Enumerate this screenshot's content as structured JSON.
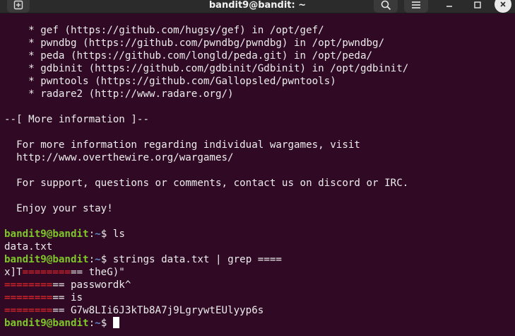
{
  "window": {
    "title": "bandit9@bandit: ~"
  },
  "prompt": {
    "user_host": "bandit9@bandit",
    "sep": ":",
    "path": "~",
    "dollar": "$"
  },
  "tools": [
    "    * gef (https://github.com/hugsy/gef) in /opt/gef/",
    "    * pwndbg (https://github.com/pwndbg/pwndbg) in /opt/pwndbg/",
    "    * peda (https://github.com/longld/peda.git) in /opt/peda/",
    "    * gdbinit (https://github.com/gdbinit/Gdbinit) in /opt/gdbinit/",
    "    * pwntools (https://github.com/Gallopsled/pwntools)",
    "    * radare2 (http://www.radare.org/)"
  ],
  "motd": {
    "more_info_header": "--[ More information ]--",
    "info_line1": "  For more information regarding individual wargames, visit",
    "info_line2": "  http://www.overthewire.org/wargames/",
    "support_line": "  For support, questions or comments, contact us on discord or IRC.",
    "enjoy_line": "  Enjoy your stay!"
  },
  "session": {
    "cmd1": " ls",
    "out1": "data.txt",
    "cmd2": " strings data.txt | grep ====",
    "result1": {
      "pre": "x]T",
      "match": "========",
      "post": "== theG)\""
    },
    "result2": {
      "match": "========",
      "post": "== passwordk^"
    },
    "result3": {
      "match": "========",
      "post": "== is"
    },
    "result4": {
      "match": "========",
      "post": "== G7w8LIi6J3kTb8A7j9LgrywtEUlyyp6s"
    }
  },
  "colors": {
    "background": "#300a24",
    "prompt_user": "#7ec62a",
    "prompt_path": "#5d8dc9",
    "grep_match": "#ef2929",
    "text": "#ececec"
  }
}
